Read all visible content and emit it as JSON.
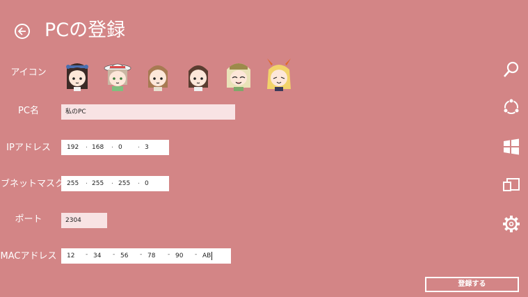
{
  "header": {
    "title": "PCの登録"
  },
  "form": {
    "icon_label": "アイコン",
    "icons": [
      "avatar-1",
      "avatar-2",
      "avatar-3",
      "avatar-4",
      "avatar-5",
      "avatar-6"
    ],
    "pc_name_label": "PC名",
    "pc_name_value": "私のPC",
    "ip_label": "IPアドレス",
    "ip_octets": [
      "192",
      "168",
      "0",
      "3"
    ],
    "subnet_label": "サブネットマスク",
    "subnet_octets": [
      "255",
      "255",
      "255",
      "0"
    ],
    "port_label": "ポート",
    "port_value": "2304",
    "mac_label": "MACアドレス",
    "mac_parts": [
      "12",
      "34",
      "56",
      "78",
      "90",
      "AB"
    ],
    "separator_dot": ".",
    "separator_dash": "-"
  },
  "actions": {
    "register_label": "登録する"
  },
  "charms": [
    "search-icon",
    "share-icon",
    "windows-start-icon",
    "devices-icon",
    "settings-icon"
  ],
  "colors": {
    "background": "#d38586",
    "field_soft": "#f8e3e4",
    "field_white": "#ffffff",
    "text": "#ffffff"
  }
}
